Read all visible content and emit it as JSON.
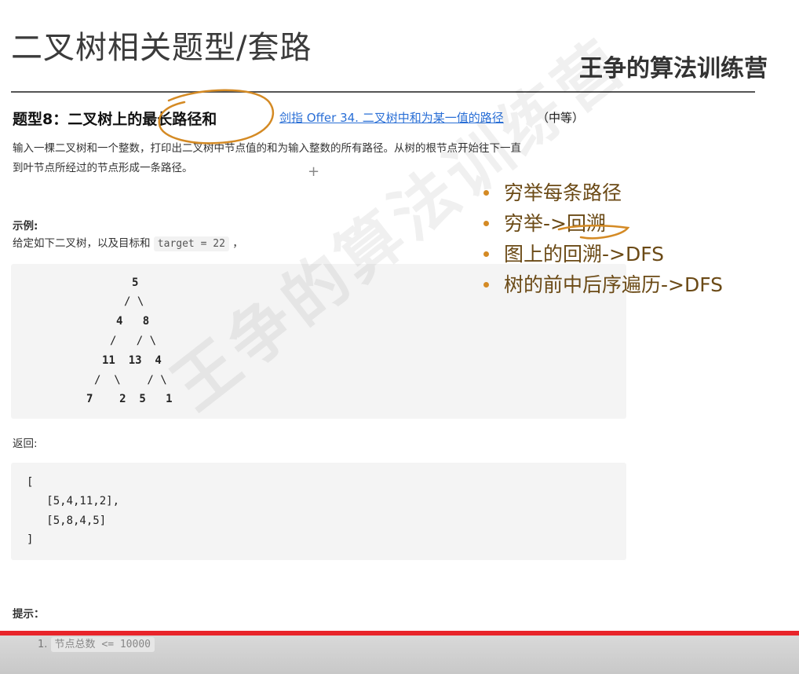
{
  "slide": {
    "title": "二叉树相关题型/套路",
    "brand": "王争的算法训练营"
  },
  "problem": {
    "title": "题型8：二叉树上的最长路径和",
    "link_text": "剑指 Offer 34. 二叉树中和为某一值的路径",
    "difficulty": "（中等）",
    "description_line1": "输入一棵二叉树和一个整数，打印出二叉树中节点值的和为输入整数的所有路径。从树的根节点开始往下一直",
    "description_line2": "到叶节点所经过的节点形成一条路径。"
  },
  "example": {
    "label": "示例:",
    "given_text": "给定如下二叉树，以及目标和",
    "target_code": "target = 22",
    "given_suffix": "，",
    "tree_lines": [
      {
        "text": "5",
        "bold": true
      },
      {
        "text": "/ \\",
        "bold": false
      },
      {
        "text": "4   8",
        "bold": true
      },
      {
        "text": "/   / \\",
        "bold": false
      },
      {
        "text": "11  13  4",
        "bold": true
      },
      {
        "text": "/  \\    / \\",
        "bold": false
      },
      {
        "text": "7    2  5   1",
        "bold": true
      }
    ],
    "return_label": "返回:",
    "result_lines": [
      "[",
      "   [5,4,11,2],",
      "   [5,8,4,5]",
      "]"
    ]
  },
  "hint": {
    "label": "提示：",
    "item_number": "1.",
    "item_code": "节点总数 <= 10000"
  },
  "annotations": {
    "bullets": [
      "穷举每条路径",
      "穷举->回溯",
      "图上的回溯->DFS",
      "树的前中后序遍历->DFS"
    ],
    "color": "#d48a24"
  },
  "watermark": "王争的算法训练营"
}
